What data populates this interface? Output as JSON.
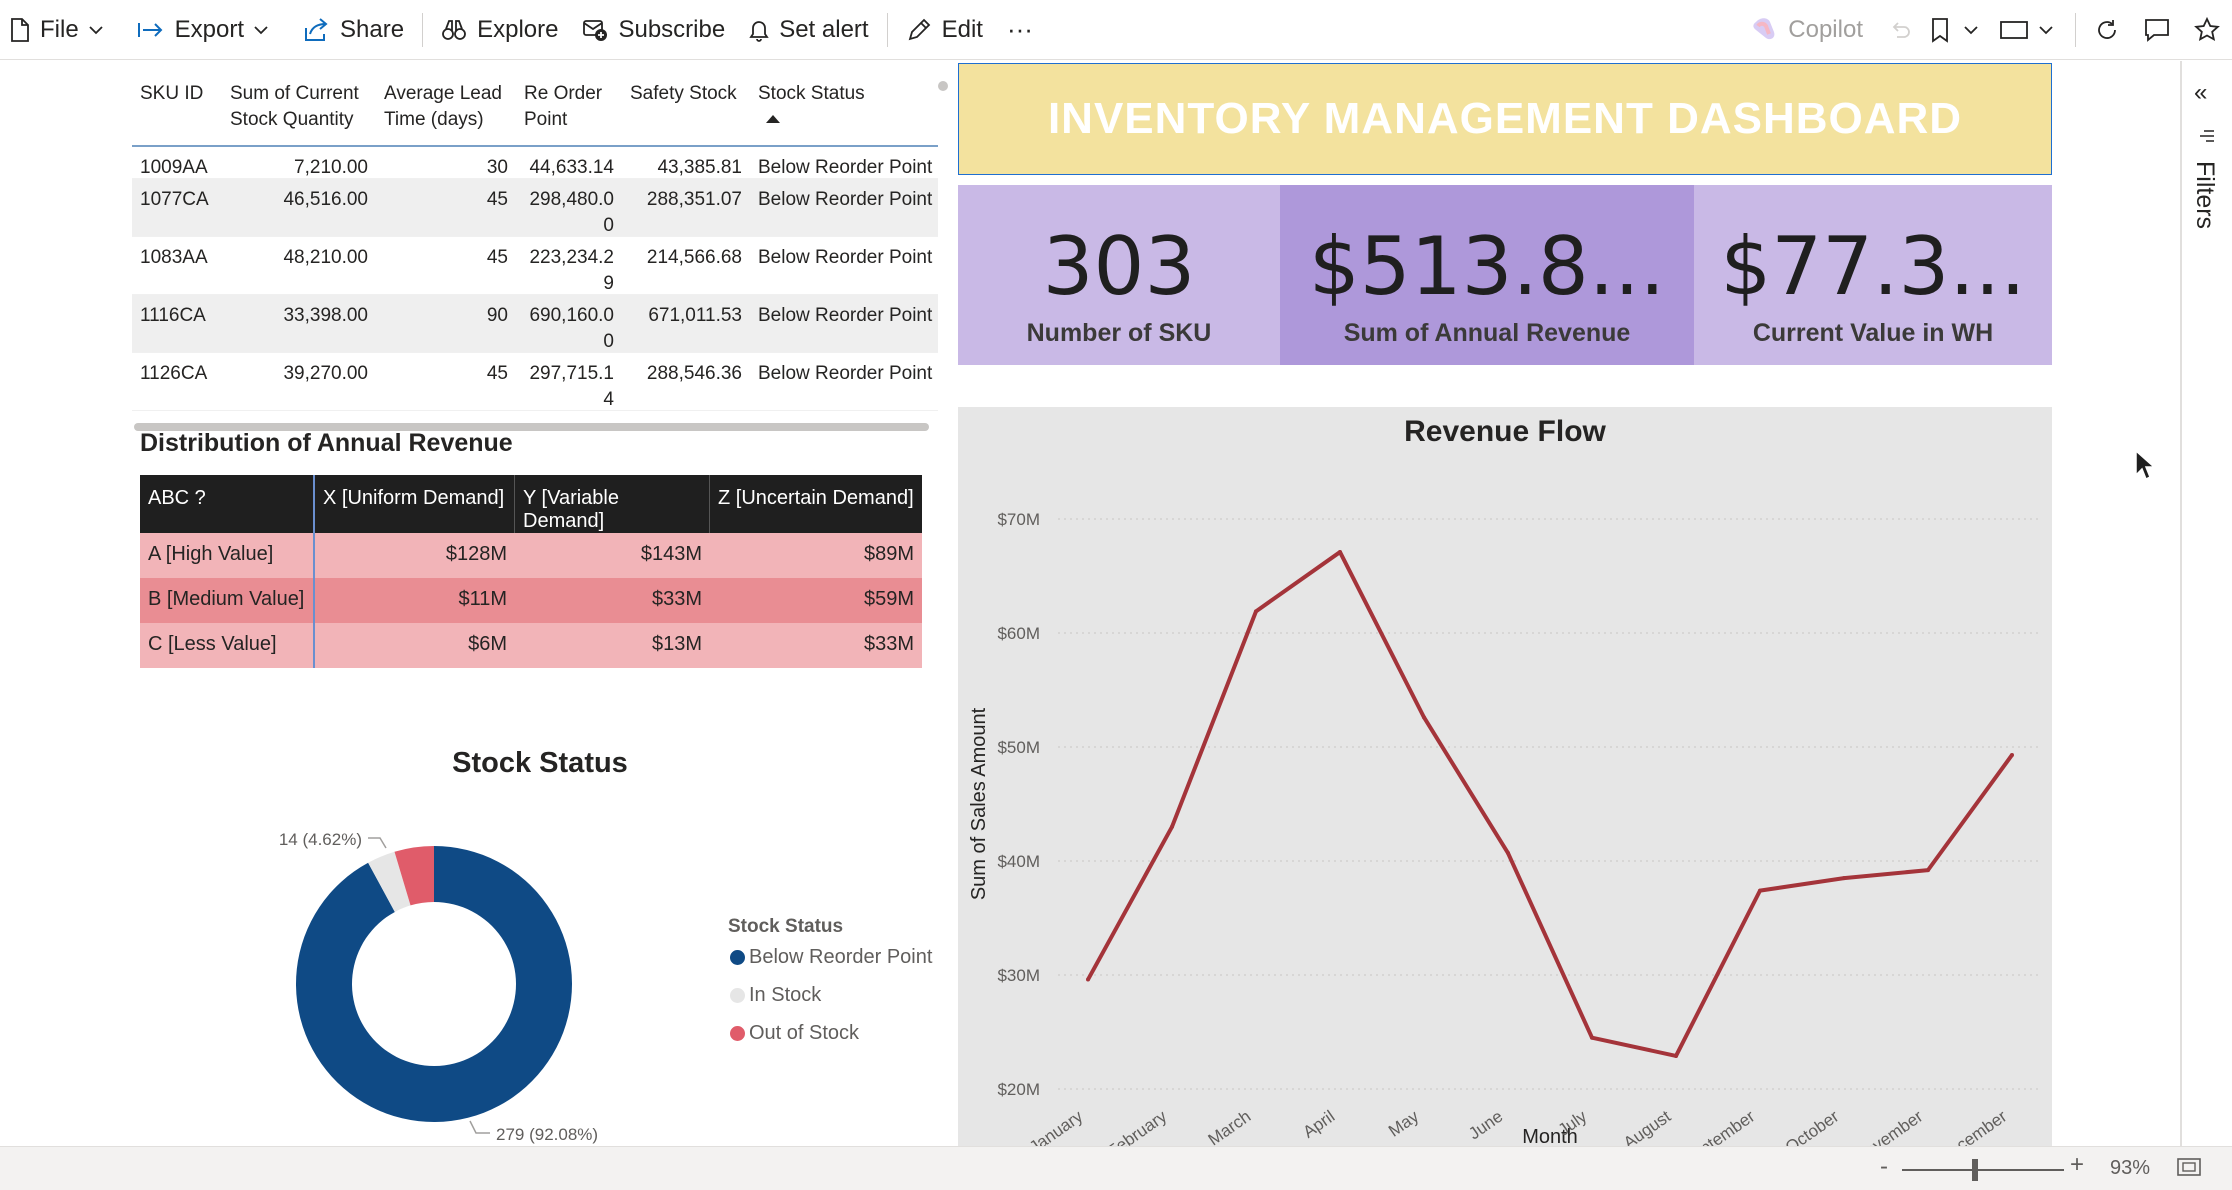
{
  "toolbar": {
    "file": "File",
    "export": "Export",
    "share": "Share",
    "explore": "Explore",
    "subscribe": "Subscribe",
    "set_alert": "Set alert",
    "edit": "Edit",
    "more": "···",
    "copilot": "Copilot"
  },
  "filters_pane": {
    "label": "Filters",
    "collapse_icon": "«"
  },
  "sku_table": {
    "headers": [
      "SKU ID",
      "Sum of Current Stock Quantity",
      "Average Lead Time (days)",
      "Re Order Point",
      "Safety Stock",
      "Stock Status"
    ],
    "rows": [
      [
        "1009AA",
        "7,210.00",
        "30",
        "44,633.14",
        "43,385.81",
        "Below Reorder Point"
      ],
      [
        "1077CA",
        "46,516.00",
        "45",
        "298,480.00",
        "288,351.07",
        "Below Reorder Point"
      ],
      [
        "1083AA",
        "48,210.00",
        "45",
        "223,234.29",
        "214,566.68",
        "Below Reorder Point"
      ],
      [
        "1116CA",
        "33,398.00",
        "90",
        "690,160.00",
        "671,011.53",
        "Below Reorder Point"
      ],
      [
        "1126CA",
        "39,270.00",
        "45",
        "297,715.14",
        "288,546.36",
        "Below Reorder Point"
      ]
    ]
  },
  "distribution": {
    "title": "Distribution of Annual Revenue",
    "headers": [
      "ABC ?",
      "X [Uniform Demand]",
      "Y [Variable Demand]",
      "Z [Uncertain Demand]"
    ],
    "rows": [
      {
        "label": "A [High Value]",
        "values": [
          "$128M",
          "$143M",
          "$89M"
        ],
        "color": "#f2b4b8"
      },
      {
        "label": "B [Medium Value]",
        "values": [
          "$11M",
          "$33M",
          "$59M"
        ],
        "color": "#e98d93"
      },
      {
        "label": "C [Less Value]",
        "values": [
          "$6M",
          "$13M",
          "$33M"
        ],
        "color": "#f2b4b8"
      }
    ]
  },
  "dashboard_title": "INVENTORY MANAGEMENT DASHBOARD",
  "kpis": [
    {
      "value": "303",
      "label": "Number of SKU"
    },
    {
      "value": "$513.8...",
      "label": "Sum of Annual Revenue"
    },
    {
      "value": "$77.3...",
      "label": "Current Value in WH"
    }
  ],
  "status_bar": {
    "zoom": "93%",
    "minus": "-",
    "plus": "+"
  },
  "chart_data": [
    {
      "type": "pie",
      "variant": "donut",
      "title": "Stock Status",
      "legend_title": "Stock Status",
      "legend_position": "right",
      "categories": [
        "Below Reorder Point",
        "In Stock",
        "Out of Stock"
      ],
      "values": [
        279,
        10,
        14
      ],
      "colors": [
        "#0f4a85",
        "#e6e6e6",
        "#e05c6a"
      ],
      "data_labels": [
        {
          "category": "Below Reorder Point",
          "text": "279 (92.08%)"
        },
        {
          "category": "Out of Stock",
          "text": "14 (4.62%)"
        }
      ]
    },
    {
      "type": "line",
      "title": "Revenue Flow",
      "xlabel": "Month",
      "ylabel": "Sum of Sales Amount",
      "categories": [
        "January",
        "February",
        "March",
        "April",
        "May",
        "June",
        "July",
        "August",
        "September",
        "October",
        "November",
        "December"
      ],
      "series": [
        {
          "values": [
            29.6,
            43.0,
            61.9,
            67.1,
            52.6,
            40.7,
            24.5,
            22.9,
            37.4,
            38.5,
            39.2,
            49.3
          ],
          "color": "#a4343a"
        }
      ],
      "ylim": [
        20,
        70
      ],
      "yticks": [
        "$20M",
        "$30M",
        "$40M",
        "$50M",
        "$60M",
        "$70M"
      ],
      "grid": true
    }
  ]
}
